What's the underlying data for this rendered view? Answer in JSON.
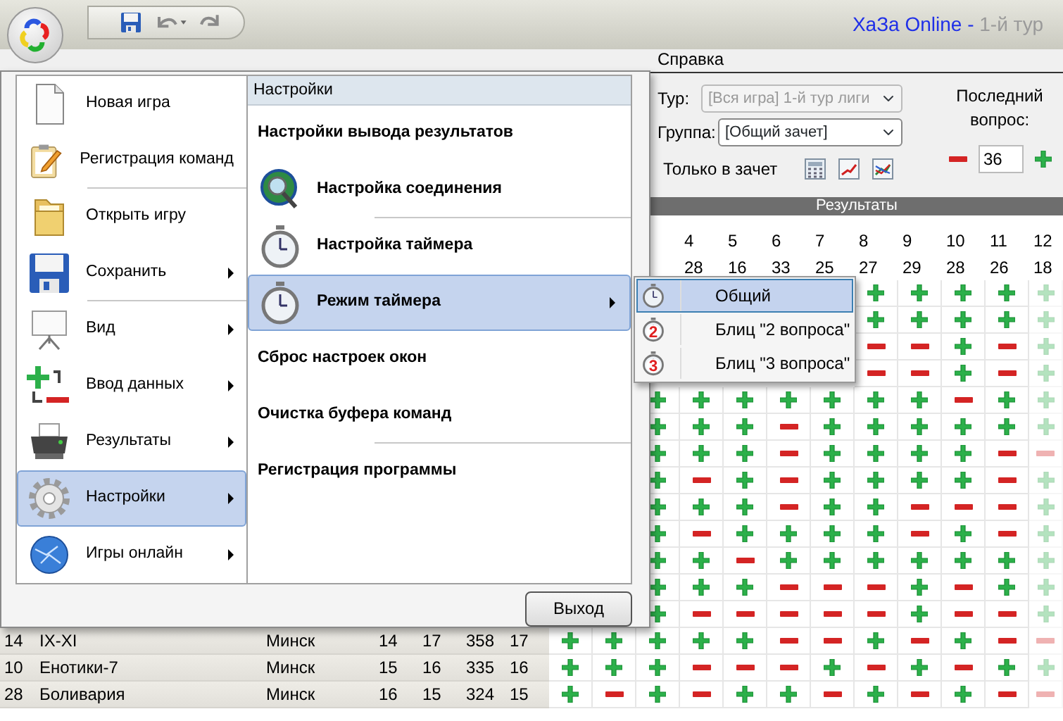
{
  "window": {
    "title_app": "ХаЗа Online -",
    "title_doc": "1-й тур"
  },
  "quick_access": [
    {
      "kind": "save"
    },
    {
      "kind": "undo"
    },
    {
      "kind": "redo"
    }
  ],
  "menubar": [
    {
      "label": "Справка"
    }
  ],
  "ribbon": {
    "tour": {
      "label": "Тур:",
      "value": "[Вся игра] 1-й тур лиги",
      "disabled": true
    },
    "group": {
      "label": "Группа:",
      "value": "[Общий зачет]",
      "disabled": false
    },
    "only_credit": {
      "label": "Только в зачет"
    },
    "tools": [
      {
        "kind": "calculator"
      },
      {
        "kind": "line-chart"
      },
      {
        "kind": "color-chart"
      }
    ],
    "last_question": {
      "label": "Последний вопрос:",
      "value": "36"
    },
    "section_title": "Результаты"
  },
  "results": {
    "columns": [
      {
        "number": "4",
        "count": "28"
      },
      {
        "number": "5",
        "count": "16"
      },
      {
        "number": "6",
        "count": "33"
      },
      {
        "number": "7",
        "count": "25"
      },
      {
        "number": "8",
        "count": "27"
      },
      {
        "number": "9",
        "count": "29"
      },
      {
        "number": "10",
        "count": "28"
      },
      {
        "number": "11",
        "count": "26"
      },
      {
        "number": "12",
        "count": "18"
      }
    ],
    "rows": [
      {
        "answers": [
          true,
          true,
          true,
          true,
          true
        ]
      },
      {
        "answers": [
          true,
          true,
          true,
          true,
          true
        ]
      },
      {
        "answers": [
          false,
          false,
          true,
          false,
          true
        ]
      },
      {
        "answers": [
          false,
          false,
          true,
          false,
          true
        ]
      },
      {
        "answers": [
          true,
          true,
          true,
          true,
          true,
          true,
          true,
          false,
          true,
          true
        ]
      },
      {
        "answers": [
          true,
          true,
          true,
          false,
          true,
          true,
          true,
          true,
          true,
          true
        ]
      },
      {
        "answers": [
          true,
          true,
          true,
          false,
          true,
          true,
          true,
          true,
          false,
          false
        ]
      },
      {
        "answers": [
          true,
          false,
          true,
          false,
          true,
          true,
          true,
          true,
          false,
          true
        ]
      },
      {
        "answers": [
          true,
          true,
          true,
          false,
          true,
          true,
          false,
          false,
          false,
          true
        ]
      },
      {
        "answers": [
          true,
          false,
          true,
          true,
          true,
          true,
          false,
          true,
          false,
          true
        ]
      },
      {
        "answers": [
          true,
          true,
          false,
          true,
          true,
          true,
          true,
          true,
          true,
          true
        ]
      },
      {
        "answers": [
          true,
          true,
          true,
          false,
          false,
          false,
          true,
          false,
          true,
          true
        ]
      },
      {
        "answers": [
          true,
          false,
          false,
          false,
          false,
          false,
          true,
          false,
          false,
          true
        ]
      },
      {
        "place": "14",
        "team": "IX-XI",
        "city": "Минск",
        "stats": [
          "14",
          "17",
          "358",
          "17"
        ],
        "answers": [
          true,
          true,
          true,
          true,
          true,
          false,
          false,
          true,
          false,
          true,
          false,
          false
        ]
      },
      {
        "place": "10",
        "team": "Енотики-7",
        "city": "Минск",
        "stats": [
          "15",
          "16",
          "335",
          "16"
        ],
        "answers": [
          true,
          true,
          true,
          false,
          false,
          false,
          true,
          false,
          true,
          false,
          true,
          true
        ]
      },
      {
        "place": "28",
        "team": "Боливария",
        "city": "Минск",
        "stats": [
          "16",
          "15",
          "324",
          "15"
        ],
        "answers": [
          true,
          false,
          true,
          false,
          true,
          true,
          false,
          true,
          false,
          true,
          false,
          false
        ]
      }
    ]
  },
  "app_menu": {
    "items": [
      {
        "label": "Новая игра",
        "kind": "document",
        "submenu": false,
        "selected": false,
        "separator_after": false
      },
      {
        "label": "Регистрация команд",
        "kind": "clipboard",
        "submenu": false,
        "selected": false,
        "separator_after": true
      },
      {
        "label": "Открыть игру",
        "kind": "folder",
        "submenu": false,
        "selected": false,
        "separator_after": false
      },
      {
        "label": "Сохранить",
        "kind": "floppy",
        "submenu": true,
        "selected": false,
        "separator_after": true
      },
      {
        "label": "Вид",
        "kind": "screen",
        "submenu": true,
        "selected": false,
        "separator_after": false
      },
      {
        "label": "Ввод данных",
        "kind": "plus-minus",
        "submenu": true,
        "selected": false,
        "separator_after": false
      },
      {
        "label": "Результаты",
        "kind": "printer",
        "submenu": true,
        "selected": false,
        "separator_after": false
      },
      {
        "label": "Настройки",
        "kind": "gear",
        "submenu": true,
        "selected": true,
        "separator_after": false
      },
      {
        "label": "Игры онлайн",
        "kind": "globe",
        "submenu": true,
        "selected": false,
        "separator_after": false
      }
    ],
    "pane": {
      "title": "Настройки",
      "items": [
        {
          "label": "Настройки вывода результатов",
          "kind": "plain",
          "submenu": false,
          "selected": false,
          "separator_after": false
        },
        {
          "label": "Настройка соединения",
          "kind": "globe-search",
          "submenu": false,
          "selected": false,
          "separator_after": true
        },
        {
          "label": "Настройка таймера",
          "kind": "stopwatch",
          "submenu": false,
          "selected": false,
          "separator_after": false
        },
        {
          "label": "Режим таймера",
          "kind": "stopwatch",
          "submenu": true,
          "selected": true,
          "separator_after": false
        },
        {
          "label": "Сброс настроек окон",
          "kind": "plain",
          "submenu": false,
          "selected": false,
          "separator_after": false
        },
        {
          "label": "Очистка буфера команд",
          "kind": "plain",
          "submenu": false,
          "selected": false,
          "separator_after": true
        },
        {
          "label": "Регистрация программы",
          "kind": "plain",
          "submenu": false,
          "selected": false,
          "separator_after": false
        }
      ]
    },
    "exit_button": "Выход"
  },
  "submenu": {
    "items": [
      {
        "label": "Общий",
        "selected": true
      },
      {
        "label": "Блиц \"2 вопроса\"",
        "badge": "2",
        "selected": false
      },
      {
        "label": "Блиц \"3 вопроса\"",
        "badge": "3",
        "selected": false
      }
    ]
  }
}
